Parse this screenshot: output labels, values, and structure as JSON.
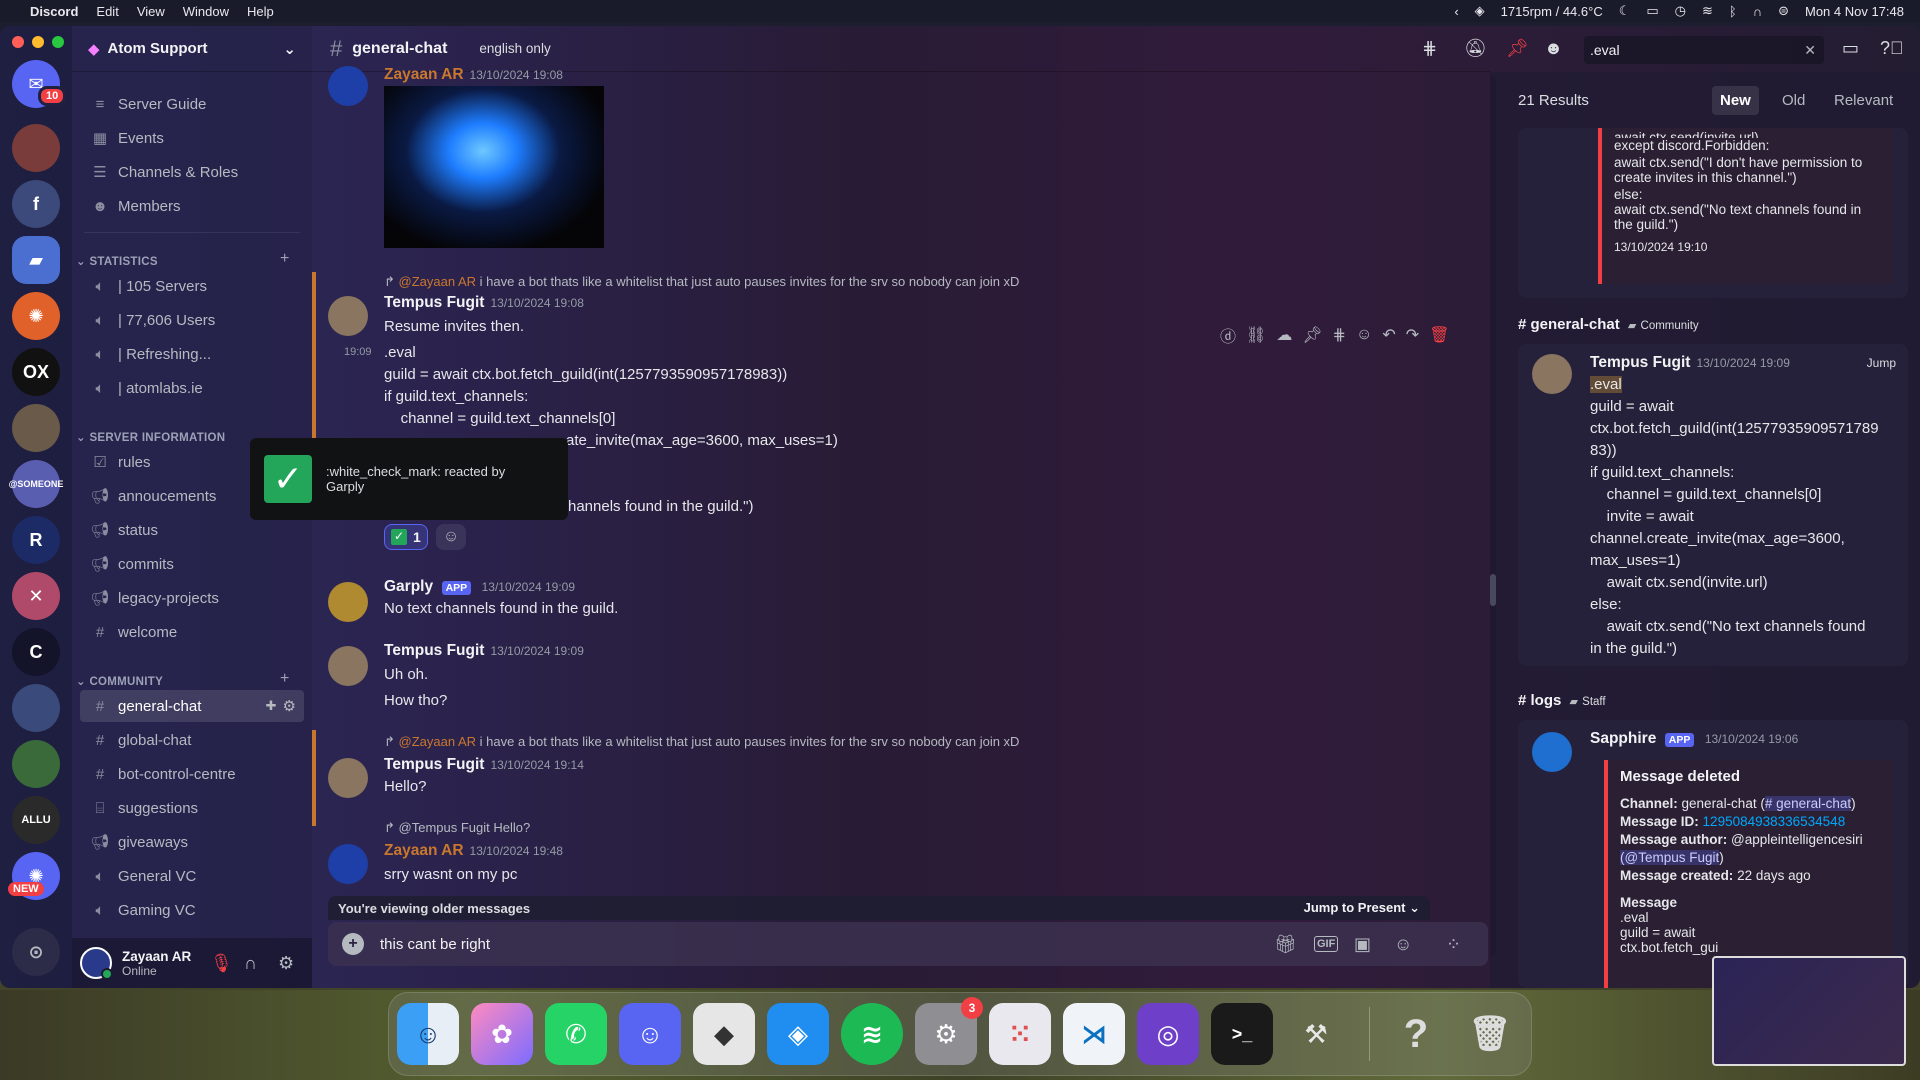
{
  "menubar": {
    "apple": "",
    "app": "Discord",
    "items": [
      "Edit",
      "View",
      "Window",
      "Help"
    ],
    "stats": "1715rpm / 44.6°C",
    "datetime": "Mon 4 Nov  17:48"
  },
  "servers": {
    "dm_badge": "10",
    "new_badge": "NEW"
  },
  "sidebar": {
    "server_name": "Atom Support",
    "top_items": [
      {
        "icon": "≡",
        "label": "Server Guide"
      },
      {
        "icon": "▦",
        "label": "Events"
      },
      {
        "icon": "☰",
        "label": "Channels & Roles"
      },
      {
        "icon": "☻",
        "label": "Members"
      }
    ],
    "cat_statistics": "STATISTICS",
    "stats": [
      "| 105 Servers",
      "| 77,606 Users",
      "| Refreshing...",
      "| atomlabs.ie"
    ],
    "cat_server_info": "SERVER INFORMATION",
    "info": [
      "rules",
      "annoucements",
      "status",
      "commits",
      "legacy-projects",
      "welcome"
    ],
    "cat_community": "COMMUNITY",
    "community": [
      "general-chat",
      "global-chat",
      "bot-control-centre",
      "suggestions",
      "giveaways",
      "General VC",
      "Gaming VC"
    ]
  },
  "user": {
    "name": "Zayaan AR",
    "status": "Online"
  },
  "chat": {
    "channel": "general-chat",
    "topic": "english only",
    "search_value": ".eval",
    "tooltip": ":white_check_mark: reacted by Garply",
    "reaction_count": "1",
    "messages": {
      "m0": {
        "author": "Zayaan AR",
        "ts": "13/10/2024 19:08"
      },
      "m1_reply": "i have a bot thats like a whitelist that just auto pauses invites for the srv so nobody can join xD",
      "m1_reply_to": "@Zayaan AR",
      "m1": {
        "author": "Tempus Fugit",
        "ts": "13/10/2024 19:08",
        "text": "Resume invites then."
      },
      "m2": {
        "time": "19:09",
        "lines": [
          ".eval",
          "guild = await ctx.bot.fetch_guild(int(1257793590957178983))",
          "if guild.text_channels:",
          "    channel = guild.text_channels[0]",
          "ate_invite(max_age=3600, max_uses=1)",
          "hannels found in the guild.\")"
        ]
      },
      "m3": {
        "author": "Garply",
        "tag": "APP",
        "ts": "13/10/2024 19:09",
        "text": "No text channels found in the guild."
      },
      "m4": {
        "author": "Tempus Fugit",
        "ts": "13/10/2024 19:09",
        "lines": [
          "Uh oh.",
          "How tho?"
        ]
      },
      "m5_reply_to": "@Zayaan AR",
      "m5_reply": "i have a bot thats like a whitelist that just auto pauses invites for the srv so nobody can join xD",
      "m5": {
        "author": "Tempus Fugit",
        "ts": "13/10/2024 19:14",
        "text": "Hello?"
      },
      "m6_reply_to": "@Tempus Fugit",
      "m6_reply": "Hello?",
      "m6": {
        "author": "Zayaan AR",
        "ts": "13/10/2024 19:48",
        "text": "srry wasnt on my pc"
      }
    },
    "older_banner": "You're viewing older messages",
    "jump_present": "Jump to Present",
    "composer_value": "this cant be right"
  },
  "search": {
    "results": "21 Results",
    "tabs": [
      "New",
      "Old",
      "Relevant"
    ],
    "top_embed": [
      "await ctx.send(invite.url)",
      "except discord.Forbidden:",
      "await ctx.send(\"I don't have permission to",
      "create invites in this channel.\")",
      "else:",
      "await ctx.send(\"No text channels found in",
      "the guild.\")",
      "13/10/2024 19:10"
    ],
    "g1_channel": "general-chat",
    "g1_cat": "Community",
    "r1": {
      "author": "Tempus Fugit",
      "ts": "13/10/2024 19:09",
      "jump": "Jump",
      "lines": [
        ".eval",
        "guild = await",
        "ctx.bot.fetch_guild(int(12577935909571789",
        "83))",
        "if guild.text_channels:",
        "    channel = guild.text_channels[0]",
        "    invite = await",
        "channel.create_invite(max_age=3600,",
        "max_uses=1)",
        "    await ctx.send(invite.url)",
        "else:",
        "    await ctx.send(\"No text channels found",
        "in the guild.\")"
      ]
    },
    "g2_channel": "logs",
    "g2_cat": "Staff",
    "r2": {
      "author": "Sapphire",
      "tag": "APP",
      "ts": "13/10/2024 19:06",
      "embed_title": "Message deleted",
      "channel_label": "Channel:",
      "channel_val": "general-chat (",
      "channel_link": "# general-chat",
      "msgid_label": "Message ID:",
      "msgid": "1295084938336534548",
      "author_label": "Message author:",
      "author_val": "@appleintelligencesiri",
      "author_mention": "(@Tempus Fugit",
      "created_label": "Message created:",
      "created_val": "22 days ago",
      "msg_label": "Message",
      "msg_lines": [
        ".eval",
        "guild = await",
        "ctx.bot.fetch_gui"
      ]
    }
  },
  "colors": {
    "blurple": "#5865f2",
    "red": "#f23f43",
    "green": "#23a55a",
    "orange": "#c9772f"
  }
}
